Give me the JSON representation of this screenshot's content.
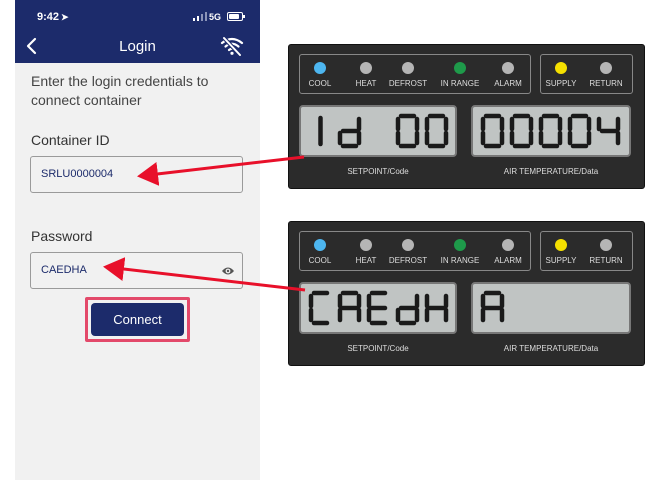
{
  "status_bar": {
    "time": "9:42",
    "network": "5G"
  },
  "nav": {
    "title": "Login"
  },
  "intro_text": "Enter the login credentials to connect container",
  "container_id": {
    "label": "Container ID",
    "value": "SRLU0000004"
  },
  "password": {
    "label": "Password",
    "value": "CAEDHA"
  },
  "connect_label": "Connect",
  "colors": {
    "brand": "#1c2b6b",
    "highlight": "#e3496a",
    "arrow": "#e8102a",
    "led_cool": "#4db6f0",
    "led_inrange": "#1e9a4a",
    "led_supply": "#f5e000",
    "led_off": "#b5b5b5"
  },
  "panels": [
    {
      "indicators": [
        {
          "label": "COOL",
          "color": "#4db6f0"
        },
        {
          "label": "HEAT",
          "color": "#b5b5b5"
        },
        {
          "label": "DEFROST",
          "color": "#b5b5b5"
        },
        {
          "label": "IN RANGE",
          "color": "#1e9a4a"
        },
        {
          "label": "ALARM",
          "color": "#b5b5b5"
        },
        {
          "label": "SUPPLY",
          "color": "#f5e000"
        },
        {
          "label": "RETURN",
          "color": "#b5b5b5"
        }
      ],
      "display_left": "Id 00",
      "display_right": "00004",
      "label_left": "SETPOINT/Code",
      "label_right": "AIR TEMPERATURE/Data"
    },
    {
      "indicators": [
        {
          "label": "COOL",
          "color": "#4db6f0"
        },
        {
          "label": "HEAT",
          "color": "#b5b5b5"
        },
        {
          "label": "DEFROST",
          "color": "#b5b5b5"
        },
        {
          "label": "IN RANGE",
          "color": "#1e9a4a"
        },
        {
          "label": "ALARM",
          "color": "#b5b5b5"
        },
        {
          "label": "SUPPLY",
          "color": "#f5e000"
        },
        {
          "label": "RETURN",
          "color": "#b5b5b5"
        }
      ],
      "display_left": "CAEdH",
      "display_right": "A",
      "label_left": "SETPOINT/Code",
      "label_right": "AIR TEMPERATURE/Data"
    }
  ]
}
